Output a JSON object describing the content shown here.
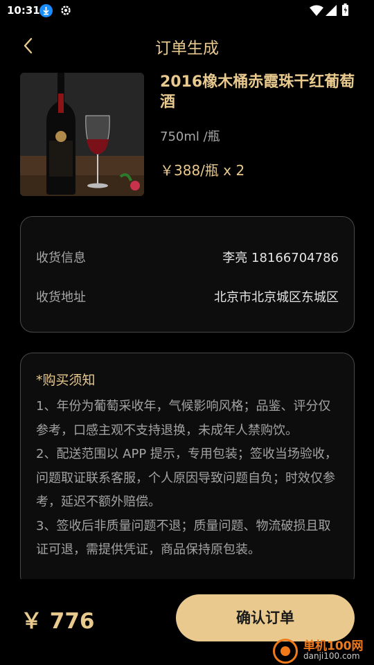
{
  "status_bar": {
    "time": "10:31",
    "icons": [
      "download-icon",
      "gear-icon",
      "wifi-icon",
      "signal-icon",
      "battery-icon"
    ]
  },
  "nav": {
    "back_icon": "chevron-left-icon",
    "title": "订单生成"
  },
  "product": {
    "image": "wine-bottle-and-glass-photo",
    "name": "2016橡木桶赤霞珠干红葡萄酒",
    "spec": "750ml /瓶",
    "price": "￥388/瓶 x 2"
  },
  "delivery": {
    "contact_label": "收货信息",
    "contact_value": "李亮 18166704786",
    "address_label": "收货地址",
    "address_value": "北京市北京城区东城区"
  },
  "notice": {
    "title": "*购买须知",
    "lines": [
      "1、年份为葡萄采收年，气候影响风格；品鉴、评分仅参考，口感主观不支持退换，未成年人禁购饮。",
      "2、配送范围以 APP 提示，专用包装；签收当场验收，问题取证联系客服，个人原因导致问题自负；时效仅参考，延迟不额外赔偿。",
      "3、签收后非质量问题不退；质量问题、物流破损且取证可退，需提供凭证，商品保持原包装。"
    ]
  },
  "footer": {
    "total": "￥ 776",
    "confirm_label": "确认订单"
  },
  "watermark": {
    "title": "单机100网",
    "domain": "danji100.com"
  },
  "colors": {
    "accent": "#e8c98e",
    "button": "#e9c98d",
    "background": "#000000",
    "card_border": "#4a4a4a",
    "muted_text": "#a8a8a8"
  }
}
